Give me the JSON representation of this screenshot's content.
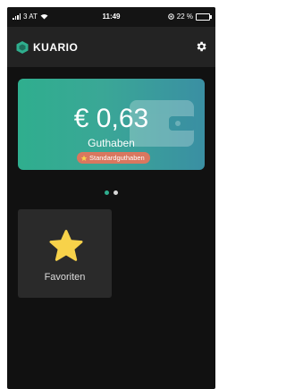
{
  "status_bar": {
    "carrier": "3 AT",
    "time": "11:49",
    "battery": "22 %"
  },
  "header": {
    "app_name": "KUARIO"
  },
  "balance_card": {
    "amount": "€ 0,63",
    "label": "Guthaben",
    "badge": "Standardguthaben"
  },
  "pager": {
    "pages": 2,
    "active": 1
  },
  "tiles": [
    {
      "label": "Favoriten",
      "icon": "star-icon"
    }
  ],
  "colors": {
    "accent_green": "#2fae8e",
    "badge": "#d9775f",
    "star": "#f7d24a",
    "background": "#111111"
  }
}
